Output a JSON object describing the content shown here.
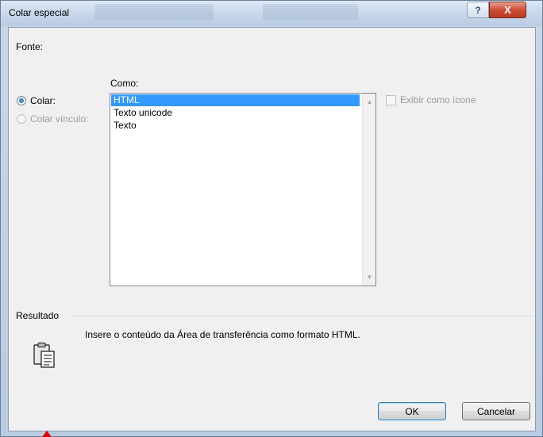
{
  "window": {
    "title": "Colar especial",
    "help_glyph": "?",
    "close_glyph": "X"
  },
  "source": {
    "label": "Fonte:"
  },
  "paste_options": {
    "colar_label": "Colar:",
    "colar_vinculo_label": "Colar vínculo:",
    "selected": "Colar:"
  },
  "como": {
    "label": "Como:",
    "items": [
      "HTML",
      "Texto unicode",
      "Texto"
    ],
    "selected": "HTML"
  },
  "display_as_icon": {
    "label": "Exibir como ícone",
    "checked": false
  },
  "result": {
    "label": "Resultado",
    "description": "Insere o conteúdo da Área de transferência como formato HTML.",
    "icon": "clipboard-paste-icon"
  },
  "buttons": {
    "ok": "OK",
    "cancel": "Cancelar"
  },
  "colors": {
    "selection": "#3399ff",
    "close_button": "#cf4b33",
    "accent_arrow": "#e00000"
  }
}
